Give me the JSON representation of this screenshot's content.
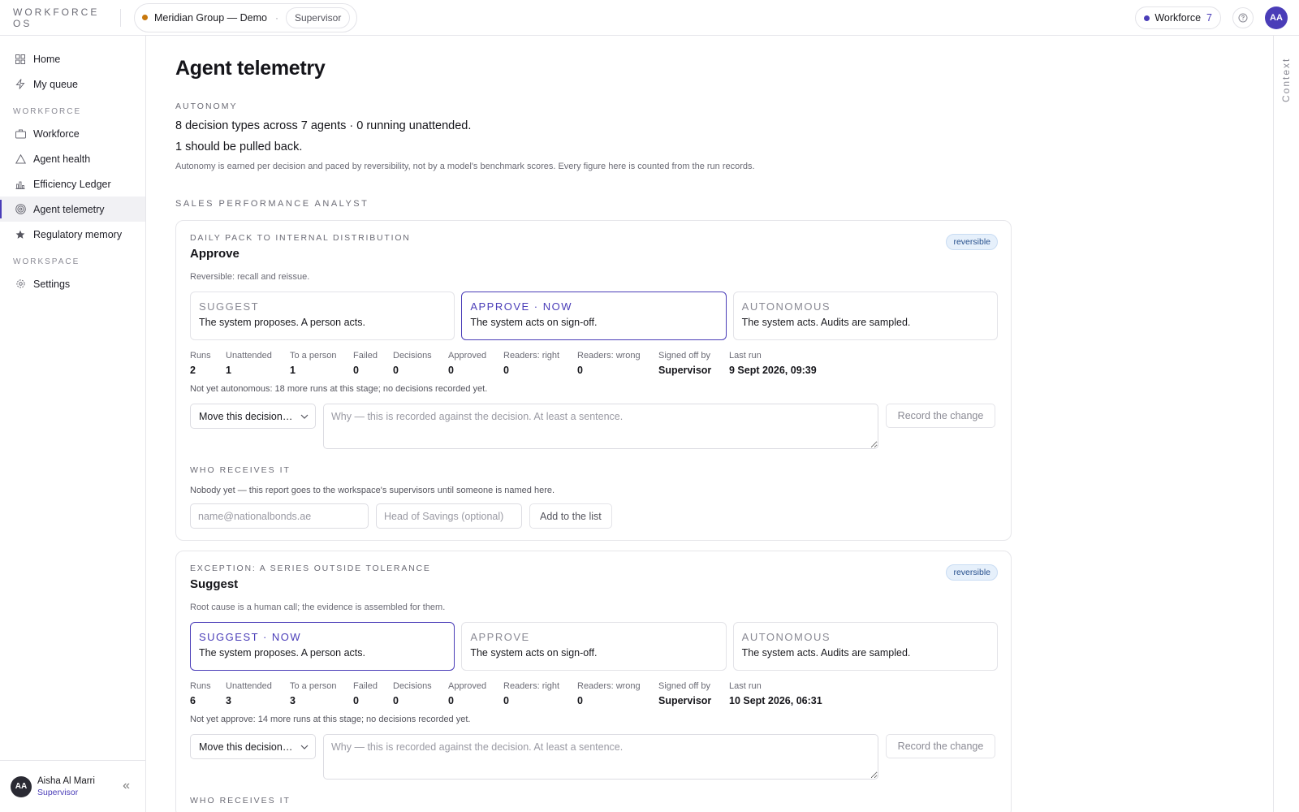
{
  "topbar": {
    "brand": "WORKFORCE OS",
    "org_name": "Meridian Group — Demo",
    "org_separator": "·",
    "role": "Supervisor",
    "workforce_label": "Workforce",
    "workforce_count": "7",
    "avatar_initials": "AA"
  },
  "sidebar": {
    "top_items": [
      {
        "label": "Home",
        "icon": "grid-icon"
      },
      {
        "label": "My queue",
        "icon": "bolt-icon"
      }
    ],
    "group_workforce": "WORKFORCE",
    "workforce_items": [
      {
        "label": "Workforce",
        "icon": "briefcase-icon"
      },
      {
        "label": "Agent health",
        "icon": "warning-triangle-icon"
      },
      {
        "label": "Efficiency Ledger",
        "icon": "bar-chart-icon"
      },
      {
        "label": "Agent telemetry",
        "icon": "radar-icon",
        "active": true
      },
      {
        "label": "Regulatory memory",
        "icon": "star-icon"
      }
    ],
    "group_workspace": "WORKSPACE",
    "workspace_items": [
      {
        "label": "Settings",
        "icon": "gear-icon"
      }
    ],
    "user": {
      "initials": "AA",
      "name": "Aisha Al Marri",
      "role": "Supervisor"
    },
    "collapse_glyph": "«"
  },
  "rail": {
    "label": "Context"
  },
  "page": {
    "title": "Agent telemetry",
    "autonomy_eyebrow": "AUTONOMY",
    "summary_line1": "8 decision types across 7 agents · 0 running unattended.",
    "summary_line2": "1 should be pulled back.",
    "note": "Autonomy is earned per decision and paced by reversibility, not by a model's benchmark scores. Every figure here is counted from the run records.",
    "section_title": "SALES PERFORMANCE ANALYST"
  },
  "metric_labels": {
    "runs": "Runs",
    "unattended": "Unattended",
    "to_person": "To a person",
    "failed": "Failed",
    "decisions": "Decisions",
    "approved": "Approved",
    "readers_right": "Readers: right",
    "readers_wrong": "Readers: wrong",
    "signed_off_by": "Signed off by",
    "last_run": "Last run"
  },
  "controls": {
    "move_select": "Move this decision…",
    "reason_placeholder": "Why — this is recorded against the decision. At least a sentence.",
    "record_button": "Record the change",
    "receives_eyebrow": "WHO RECEIVES IT",
    "receives_note": "Nobody yet — this report goes to the workspace's supervisors until someone is named here.",
    "email_placeholder": "name@nationalbonds.ae",
    "role_placeholder": "Head of Savings (optional)",
    "add_button": "Add to the list"
  },
  "cards": [
    {
      "eyebrow": "DAILY PACK TO INTERNAL DISTRIBUTION",
      "title": "Approve",
      "badge": "reversible",
      "subtitle": "Reversible: recall and reissue.",
      "stages": [
        {
          "name": "SUGGEST",
          "desc": "The system proposes. A person acts."
        },
        {
          "name": "APPROVE · NOW",
          "desc": "The system acts on sign-off."
        },
        {
          "name": "AUTONOMOUS",
          "desc": "The system acts. Audits are sampled."
        }
      ],
      "metrics": {
        "runs": "2",
        "unattended": "1",
        "to_person": "1",
        "failed": "0",
        "decisions": "0",
        "approved": "0",
        "readers_right": "0",
        "readers_wrong": "0",
        "signed_off_by": "Supervisor",
        "last_run": "9 Sept 2026, 09:39"
      },
      "status": "Not yet autonomous: 18 more runs at this stage; no decisions recorded yet."
    },
    {
      "eyebrow": "EXCEPTION: A SERIES OUTSIDE TOLERANCE",
      "title": "Suggest",
      "badge": "reversible",
      "subtitle": "Root cause is a human call; the evidence is assembled for them.",
      "stages": [
        {
          "name": "SUGGEST · NOW",
          "desc": "The system proposes. A person acts."
        },
        {
          "name": "APPROVE",
          "desc": "The system acts on sign-off."
        },
        {
          "name": "AUTONOMOUS",
          "desc": "The system acts. Audits are sampled."
        }
      ],
      "metrics": {
        "runs": "6",
        "unattended": "3",
        "to_person": "3",
        "failed": "0",
        "decisions": "0",
        "approved": "0",
        "readers_right": "0",
        "readers_wrong": "0",
        "signed_off_by": "Supervisor",
        "last_run": "10 Sept 2026, 06:31"
      },
      "status": "Not yet approve: 14 more runs at this stage; no decisions recorded yet."
    }
  ],
  "colors": {
    "accent": "#4a3db8",
    "org_dot": "#c8780c",
    "badge_bg": "#e6f0fb",
    "badge_text": "#264f8c"
  }
}
